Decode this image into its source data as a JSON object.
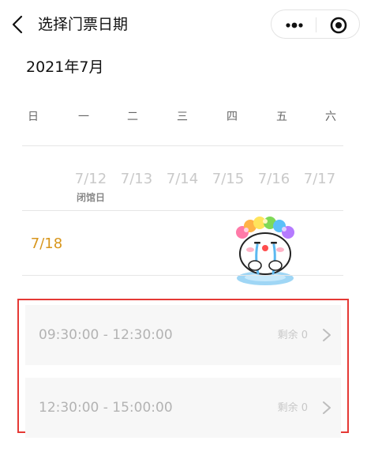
{
  "nav": {
    "title": "选择门票日期",
    "back_icon": "chevron-left-icon",
    "more_icon": "more-dots-icon",
    "close_icon": "target-close-icon"
  },
  "calendar": {
    "month": "2021年7月",
    "weekdays": [
      "日",
      "一",
      "二",
      "三",
      "四",
      "五",
      "六"
    ],
    "week1": [
      {
        "date": "7/12",
        "note": "闭馆日"
      },
      {
        "date": "7/13",
        "note": ""
      },
      {
        "date": "7/14",
        "note": ""
      },
      {
        "date": "7/15",
        "note": ""
      },
      {
        "date": "7/16",
        "note": ""
      },
      {
        "date": "7/17",
        "note": ""
      }
    ],
    "selected_date": "7/18"
  },
  "slots": [
    {
      "time": "09:30:00 - 12:30:00",
      "remaining": "剩余 0"
    },
    {
      "time": "12:30:00 - 15:00:00",
      "remaining": "剩余 0"
    }
  ],
  "colors": {
    "accent": "#d8961c",
    "highlight_border": "#e53935",
    "muted_text": "#c9c9c9"
  }
}
